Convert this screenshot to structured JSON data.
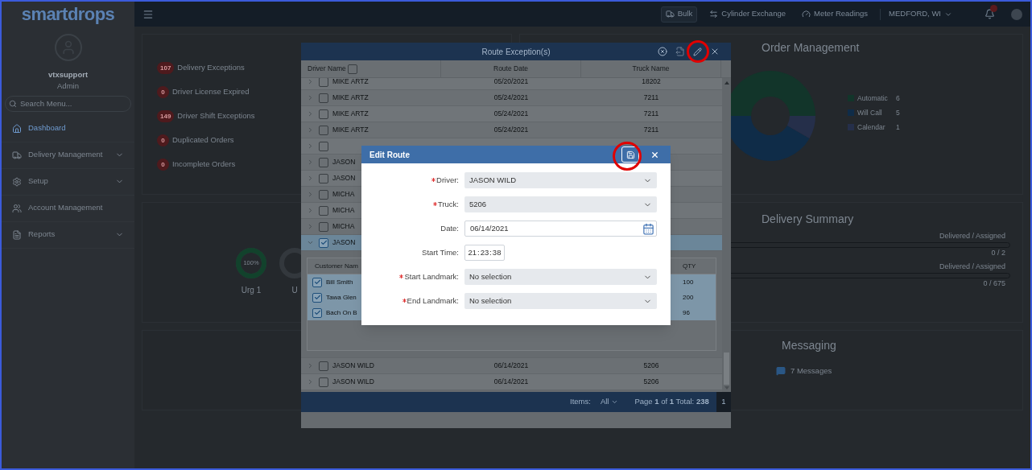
{
  "logo": {
    "text": "smartdrops"
  },
  "user": {
    "name": "vtxsupport",
    "role": "Admin"
  },
  "search": {
    "placeholder": "Search Menu..."
  },
  "nav": [
    {
      "label": "Dashboard",
      "selected": true,
      "expandable": false
    },
    {
      "label": "Delivery Management",
      "selected": false,
      "expandable": true
    },
    {
      "label": "Setup",
      "selected": false,
      "expandable": true
    },
    {
      "label": "Account Management",
      "selected": false,
      "expandable": false
    },
    {
      "label": "Reports",
      "selected": false,
      "expandable": true
    }
  ],
  "topbar": {
    "shortcuts": [
      {
        "label": "Bulk",
        "selected": true
      },
      {
        "label": "Cylinder Exchange",
        "selected": false
      },
      {
        "label": "Meter Readings",
        "selected": false
      }
    ],
    "location": "MEDFORD, WI"
  },
  "exceptions": [
    {
      "count": "107",
      "label": "Delivery Exceptions"
    },
    {
      "count": "0",
      "label": "Driver License Expired"
    },
    {
      "count": "149",
      "label": "Driver Shift Exceptions"
    },
    {
      "count": "0",
      "label": "Duplicated Orders"
    },
    {
      "count": "0",
      "label": "Incomplete Orders"
    }
  ],
  "order_management": {
    "title": "Order Management",
    "chart_data": {
      "type": "donut",
      "categories": [
        "Automatic",
        "Will Call",
        "Calendar"
      ],
      "series": [
        {
          "values": [
            50,
            41.7,
            8.3
          ]
        }
      ]
    },
    "legend": [
      {
        "value": "6",
        "color": "#12352a"
      },
      {
        "value": "5",
        "color": "#0f2c48"
      },
      {
        "value": "1",
        "color": "#252f4a"
      }
    ]
  },
  "gauges": [
    {
      "label": "Urg 1",
      "reading": "100%",
      "level": 1
    },
    {
      "label": "U"
    }
  ],
  "delivery_summary": {
    "title": "Delivery Summary",
    "rows": [
      {
        "caption": "Delivered / Assigned",
        "level": 0,
        "reading": "0 / 2"
      },
      {
        "caption": "Delivered / Assigned",
        "level": 0,
        "reading": "0 / 675"
      }
    ]
  },
  "messaging": {
    "title": "Messaging",
    "text": "7 Messages"
  },
  "route_exceptions": {
    "title": "Route Exception(s)",
    "columns": [
      "Driver Name",
      "Route Date",
      "Truck Name"
    ],
    "header_checked": false,
    "rows": [
      {
        "driver": "MIKE ARTZ",
        "date": "05/20/2021",
        "truck": "18202",
        "checked": false,
        "expanded": false,
        "selected": false
      },
      {
        "driver": "MIKE ARTZ",
        "date": "05/24/2021",
        "truck": "7211",
        "checked": false,
        "expanded": false,
        "selected": false
      },
      {
        "driver": "MIKE ARTZ",
        "date": "05/24/2021",
        "truck": "7211",
        "checked": false,
        "expanded": false,
        "selected": false
      },
      {
        "driver": "MIKE ARTZ",
        "date": "05/24/2021",
        "truck": "7211",
        "checked": false,
        "expanded": false,
        "selected": false
      },
      {
        "checked": false,
        "expanded": false,
        "selected": false
      },
      {
        "driver": "JASON",
        "checked": false,
        "expanded": false,
        "selected": false
      },
      {
        "driver": "JASON",
        "checked": false,
        "expanded": false,
        "selected": false
      },
      {
        "driver": "MICHA",
        "checked": false,
        "expanded": false,
        "selected": false
      },
      {
        "driver": "MICHA",
        "checked": false,
        "expanded": false,
        "selected": false
      },
      {
        "driver": "MICHA",
        "checked": false,
        "expanded": false,
        "selected": false
      },
      {
        "driver": "JASON",
        "checked": true,
        "expanded": true,
        "selected": true,
        "detail": {
          "columns": [
            "Customer Nam",
            "QTY"
          ],
          "rows": [
            {
              "customer": "Bill Smith",
              "qty": "100",
              "checked": true
            },
            {
              "customer": "Tawa Glen",
              "qty": "200",
              "checked": true
            },
            {
              "customer": "Bach On B",
              "qty": "96",
              "checked": true
            }
          ]
        }
      },
      {
        "driver": "JASON WILD",
        "date": "06/14/2021",
        "truck": "5206",
        "checked": false,
        "expanded": false,
        "selected": false
      },
      {
        "driver": "JASON WILD",
        "date": "06/14/2021",
        "truck": "5206",
        "checked": false,
        "expanded": false,
        "selected": false
      }
    ],
    "footer": {
      "items_label": "Items:",
      "items_value": "All",
      "page_info": "Page **1** of **1** Total: **238**",
      "page": "1"
    }
  },
  "edit_route": {
    "title": "Edit Route",
    "fields": [
      {
        "label": "Driver:",
        "required": true,
        "kind": "select",
        "value": "JASON WILD"
      },
      {
        "label": "Truck:",
        "required": true,
        "kind": "select",
        "value": "5206"
      },
      {
        "label": "Date:",
        "required": false,
        "kind": "date",
        "value": "06/14/2021"
      },
      {
        "label": "Start Time:",
        "required": false,
        "kind": "time",
        "parts": [
          "21",
          "23",
          "38"
        ],
        "separator": ":"
      },
      {
        "label": "Start Landmark:",
        "required": true,
        "kind": "select",
        "value": "No selection"
      },
      {
        "label": "End Landmark:",
        "required": true,
        "kind": "select",
        "value": "No selection"
      }
    ]
  }
}
